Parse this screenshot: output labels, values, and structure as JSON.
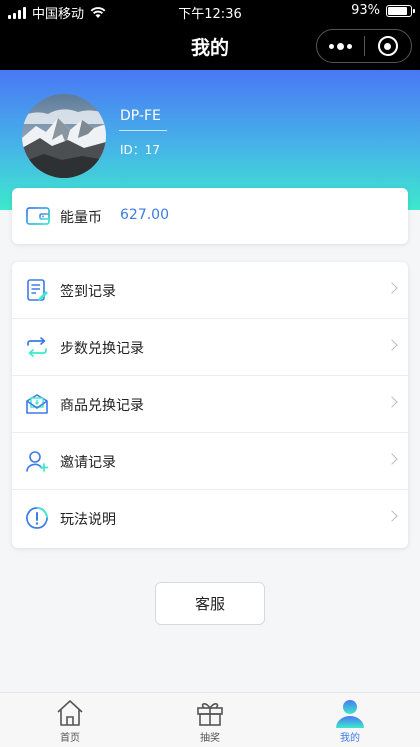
{
  "status_bar": {
    "carrier": "中国移动",
    "time": "下午12:36",
    "battery": "93%"
  },
  "nav": {
    "title": "我的"
  },
  "profile": {
    "name": "DP-FE",
    "id_label": "ID：17"
  },
  "energy": {
    "label": "能量币",
    "value": "627.00"
  },
  "menu": {
    "items": [
      {
        "label": "签到记录",
        "icon": "checkin-record-icon"
      },
      {
        "label": "步数兑换记录",
        "icon": "exchange-arrows-icon"
      },
      {
        "label": "商品兑换记录",
        "icon": "mail-envelope-icon"
      },
      {
        "label": "邀请记录",
        "icon": "add-user-icon"
      },
      {
        "label": "玩法说明",
        "icon": "info-exclamation-icon"
      }
    ]
  },
  "customer_service": {
    "label": "客服"
  },
  "tabbar": {
    "items": [
      {
        "label": "首页",
        "icon": "home-icon"
      },
      {
        "label": "抽奖",
        "icon": "gift-icon"
      },
      {
        "label": "我的",
        "icon": "profile-icon",
        "active": true
      }
    ]
  },
  "colors": {
    "accent": "#3d7be8",
    "gradient_top": "#4a78f5",
    "gradient_bottom": "#3de9cb"
  }
}
